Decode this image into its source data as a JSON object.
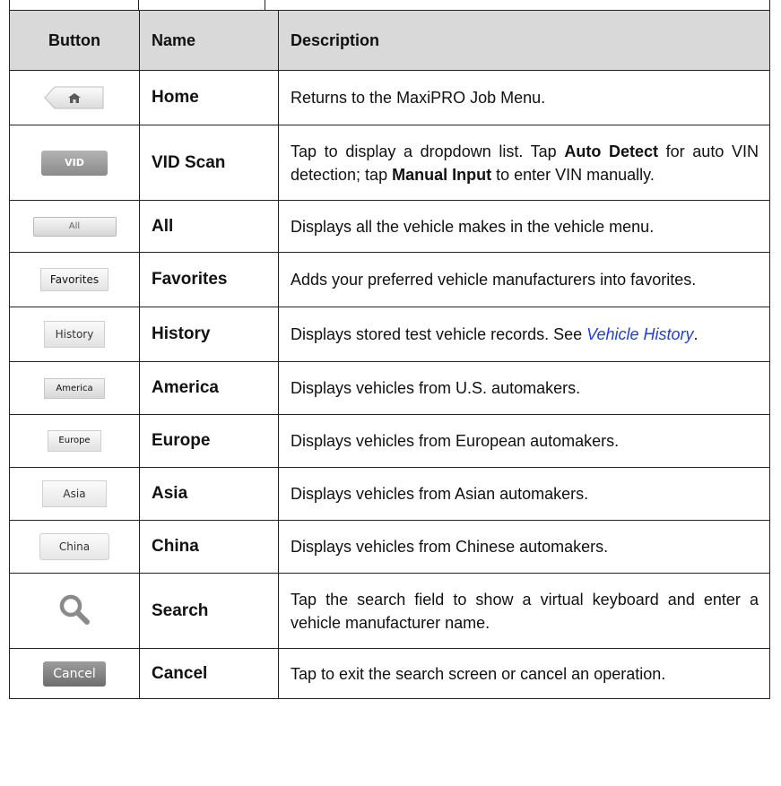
{
  "table": {
    "headers": {
      "button": "Button",
      "name": "Name",
      "description": "Description"
    },
    "rows": [
      {
        "icon": "home-button-icon",
        "name": "Home",
        "desc_parts": [
          "Returns to the MaxiPRO Job Menu."
        ]
      },
      {
        "icon": "vid-scan-button-icon",
        "icon_text": "VID",
        "name": "VID Scan",
        "desc_parts": [
          "Tap to display a dropdown list. Tap ",
          "Auto Detect",
          " for auto VIN detection; tap ",
          "Manual Input",
          " to enter VIN manually."
        ]
      },
      {
        "icon": "all-button-icon",
        "icon_text": "All",
        "name": "All",
        "desc_parts": [
          "Displays all the vehicle makes in the vehicle menu."
        ]
      },
      {
        "icon": "favorites-button-icon",
        "icon_text": "Favorites",
        "name": "Favorites",
        "desc_parts": [
          "Adds your preferred vehicle manufacturers into favorites."
        ]
      },
      {
        "icon": "history-button-icon",
        "icon_text": "History",
        "name": "History",
        "desc_parts": [
          "Displays stored test vehicle records. See ",
          "Vehicle History",
          "."
        ]
      },
      {
        "icon": "america-button-icon",
        "icon_text": "America",
        "name": "America",
        "desc_parts": [
          "Displays vehicles from U.S. automakers."
        ]
      },
      {
        "icon": "europe-button-icon",
        "icon_text": "Europe",
        "name": "Europe",
        "desc_parts": [
          "Displays vehicles from European automakers."
        ]
      },
      {
        "icon": "asia-button-icon",
        "icon_text": "Asia",
        "name": "Asia",
        "desc_parts": [
          "Displays vehicles from Asian automakers."
        ]
      },
      {
        "icon": "china-button-icon",
        "icon_text": "China",
        "name": "China",
        "desc_parts": [
          "Displays vehicles from Chinese automakers."
        ]
      },
      {
        "icon": "search-icon",
        "name": "Search",
        "desc_parts": [
          "Tap the search field to show a virtual keyboard and enter a vehicle manufacturer name."
        ]
      },
      {
        "icon": "cancel-button-icon",
        "icon_text": "Cancel",
        "name": "Cancel",
        "desc_parts": [
          "Tap to exit the search screen or cancel an operation."
        ]
      }
    ]
  },
  "colors": {
    "header_bg": "#d9d9d9",
    "border": "#222222",
    "link": "#1f3fd6"
  }
}
